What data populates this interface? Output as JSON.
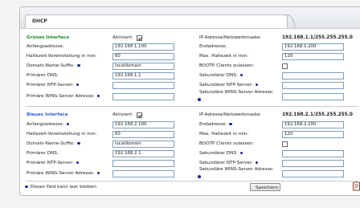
{
  "tab": {
    "title": "DHCP"
  },
  "green": {
    "title": "Grünes Interface",
    "activated_label": "Aktiviert:",
    "activated": true,
    "netmask_label": "IP-Adresse/Netzwerkmaske:",
    "netmask_value": "192.168.1.1/255.255.255.0",
    "start_label": "Anfangsadresse:",
    "start_value": "192.168.1.100",
    "end_label": "Endadresse:",
    "end_value": "192.168.1.200",
    "default_lease_label": "Haltezeit-Voreinstellung in min:",
    "default_lease_value": "60",
    "max_lease_label": "Max. Haltezeit in min:",
    "max_lease_value": "120",
    "domain_label": "Domain-Name-Suffix:",
    "domain_value": "localdomain",
    "bootp_label": "BOOTP Clients zulassen:",
    "bootp": false,
    "dns1_label": "Primärer DNS:",
    "dns1_value": "192.168.1.1",
    "dns2_label": "Sekundärer DNS:",
    "dns2_value": "",
    "ntp1_label": "Primärer NTP-Server:",
    "ntp1_value": "",
    "ntp2_label": "Sekundärer NTP-Server:",
    "ntp2_value": "",
    "wins1_label": "Primäre WINS-Server Adresse:",
    "wins1_value": "",
    "wins2_label": "Sekundäre WINS-Server Adresse:",
    "wins2_value": ""
  },
  "blue": {
    "title": "Blaues Interface",
    "activated_label": "Aktiviert:",
    "activated": true,
    "netmask_label": "IP-Adresse/Netzwerkmaske:",
    "netmask_value": "192.168.2.1/255.255.255.0",
    "start_label": "Anfangsadresse:",
    "start_value": "192.168.2.100",
    "end_label": "Endadresse:",
    "end_value": "192.168.2.200",
    "default_lease_label": "Haltezeit-Voreinstellung in min:",
    "default_lease_value": "60",
    "max_lease_label": "Max. Haltezeit in min:",
    "max_lease_value": "120",
    "domain_label": "Domain-Name-Suffix:",
    "domain_value": "localdomain",
    "bootp_label": "BOOTP Clients zulassen:",
    "bootp": false,
    "dns1_label": "Primärer DNS:",
    "dns1_value": "192.168.2.1",
    "dns2_label": "Sekundärer DNS:",
    "dns2_value": "",
    "ntp1_label": "Primärer NTP-Server:",
    "ntp1_value": "",
    "ntp2_label": "Sekundärer NTP-Server:",
    "ntp2_value": "",
    "wins1_label": "Primäre WINS-Server Adresse:",
    "wins1_value": "",
    "wins2_label": "Sekundäre WINS-Server Adresse:",
    "wins2_value": ""
  },
  "footer": {
    "note": "Dieses Feld kann leer bleiben.",
    "save_label": "Speichern"
  },
  "colors": {
    "green_title": "#1a8a2e",
    "blue_title": "#2a5bd7",
    "optional_dot": "#1f2a8a"
  }
}
